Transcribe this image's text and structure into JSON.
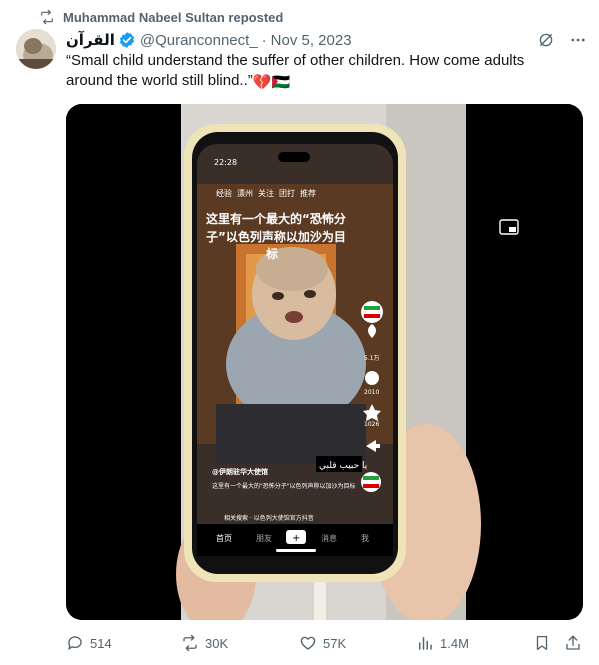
{
  "repost": {
    "label": "Muhammad Nabeel Sultan reposted",
    "icon": "retweet-icon"
  },
  "tweet": {
    "display_name": "القرآن",
    "handle": "@Quranconnect_",
    "separator": "·",
    "date": "Nov 5, 2023",
    "text": "“Small child understand the suffer of other children. How come adults around the world still blind..”",
    "emoji_text": "💔🇵🇸"
  },
  "video": {
    "overlay_lines": [
      "这里有一个最大的“恐怖分",
      "子”以色列声称以加沙为目",
      "标"
    ],
    "top_time": "22:28",
    "top_tabs": [
      "经验",
      "漂州",
      "关注",
      "团打",
      "推荐"
    ],
    "side_counts": [
      "5.1万",
      "2010",
      "1026"
    ],
    "caption_arabic": "يا حبيب قلبي",
    "caption_account": "@伊朗驻华大使馆",
    "caption_line": "这里有一个最大的\"恐怖分子\"以色列声称以加沙为目标",
    "search_hint": "相关搜索 · 以色列大使馆官方抖音",
    "bottom_tabs": [
      "首页",
      "朋友",
      "+",
      "消息",
      "我"
    ]
  },
  "actions": {
    "replies": "514",
    "retweets": "30K",
    "likes": "57K",
    "views": "1.4M"
  },
  "colors": {
    "verified": "#1d9bf0",
    "text_secondary": "#536471",
    "text_primary": "#0f1419"
  }
}
